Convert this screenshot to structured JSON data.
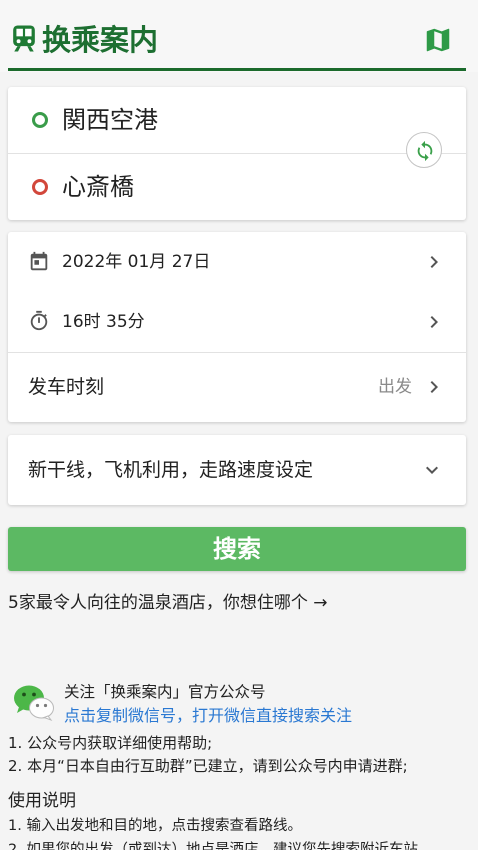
{
  "header": {
    "title": "换乘案内"
  },
  "route": {
    "from": "関西空港",
    "to": "心斎橋"
  },
  "schedule": {
    "date": "2022年 01月 27日",
    "time": "16时 35分",
    "departure_label": "发车时刻",
    "departure_mode": "出发"
  },
  "options": {
    "label": "新干线，飞机利用，走路速度设定"
  },
  "search": {
    "label": "搜索"
  },
  "promo": {
    "text": "5家最令人向往的温泉酒店，你想住哪个 →"
  },
  "wechat": {
    "title": "关注「换乘案内」官方公众号",
    "link": "点击复制微信号，打开微信直接搜索关注"
  },
  "notes": [
    "1. 公众号内获取详细使用帮助;",
    "2. 本月“日本自由行互助群”已建立，请到公众号内申请进群;"
  ],
  "usage": {
    "heading": "使用说明",
    "items": [
      "1. 输入出发地和目的地，点击搜索查看路线。",
      "2. 如果您的出发（或到达）地点是酒店，建议您先搜索附近车站。"
    ]
  },
  "icons": {
    "app": "train-icon",
    "map": "map-icon",
    "swap": "swap-icon",
    "date": "calendar-icon",
    "time": "timer-icon",
    "row_arrow": "chevron-right-icon",
    "expand": "chevron-down-icon",
    "wechat": "wechat-icon"
  },
  "colors": {
    "brand_green": "#1d6f31",
    "button_green": "#5cb963",
    "from_marker": "#3a9c4a",
    "to_marker": "#d2473b",
    "link_blue": "#2a78d2",
    "secondary_text": "#8a8a8a"
  }
}
